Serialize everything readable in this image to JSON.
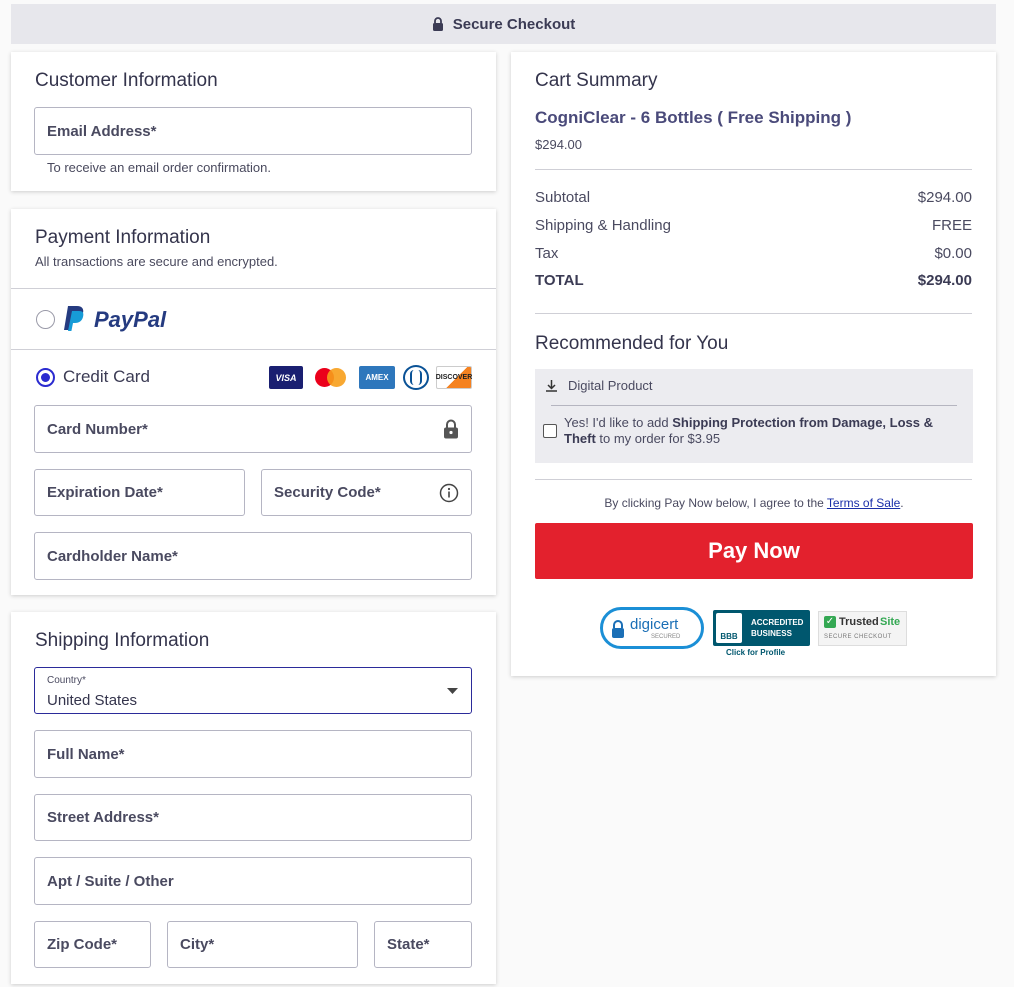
{
  "header": {
    "title": "Secure Checkout",
    "lock_icon": "lock-icon"
  },
  "customer": {
    "heading": "Customer Information",
    "email_placeholder": "Email Address*",
    "email_hint": "To receive an email order confirmation."
  },
  "payment": {
    "heading": "Payment Information",
    "subheading": "All transactions are secure and encrypted.",
    "paypal_label": "PayPal",
    "credit_card_label": "Credit Card",
    "card_logos": [
      "VISA",
      "Mastercard",
      "AMEX",
      "Diners",
      "DISCOVER"
    ],
    "card_number": "Card Number*",
    "expiration": "Expiration Date*",
    "security_code": "Security Code*",
    "cardholder": "Cardholder Name*"
  },
  "shipping": {
    "heading": "Shipping Information",
    "country_label": "Country*",
    "country_value": "United States",
    "full_name": "Full Name*",
    "street": "Street Address*",
    "apt": "Apt / Suite / Other",
    "zip": "Zip Code*",
    "city": "City*",
    "state": "State*"
  },
  "cart": {
    "heading": "Cart Summary",
    "product_name": "CogniClear - 6 Bottles ( Free Shipping )",
    "product_price": "$294.00",
    "rows": [
      {
        "label": "Subtotal",
        "value": "$294.00"
      },
      {
        "label": "Shipping & Handling",
        "value": "FREE"
      },
      {
        "label": "Tax",
        "value": "$0.00"
      },
      {
        "label": "TOTAL",
        "value": "$294.00"
      }
    ],
    "recommended_heading": "Recommended for You",
    "digital_product": "Digital Product",
    "protection_pre": "Yes! I'd like to add ",
    "protection_bold": "Shipping Protection from Damage, Loss & Theft",
    "protection_post": " to my order for $3.95",
    "agree_pre": "By clicking Pay Now below, I agree to the ",
    "agree_link": "Terms of Sale",
    "agree_post": ".",
    "pay_button": "Pay Now"
  },
  "badges": {
    "digicert": "digicert",
    "digicert_sub": "SECURED",
    "bbb_line1": "ACCREDITED",
    "bbb_line2": "BUSINESS",
    "bbb_logo": "BBB",
    "bbb_caption": "Click for Profile",
    "trusted_a": "Trusted",
    "trusted_b": "Site",
    "trusted_sub": "SECURE CHECKOUT"
  },
  "colors": {
    "accent": "#2b2bd0",
    "pay_button": "#e3212d",
    "paypal_dark": "#253b80",
    "paypal_light": "#179bd7"
  }
}
